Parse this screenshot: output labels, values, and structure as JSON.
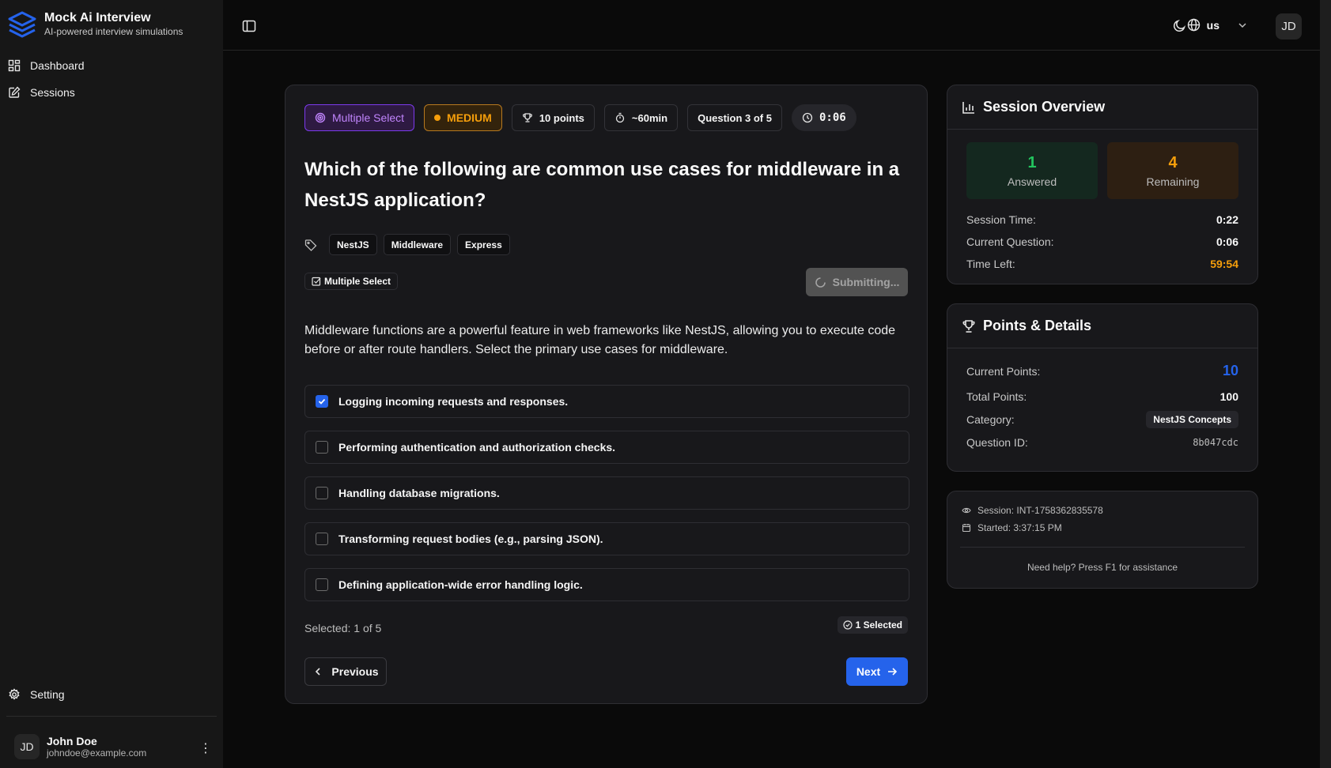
{
  "app": {
    "title": "Mock Ai Interview",
    "subtitle": "AI-powered interview simulations"
  },
  "sidebar": {
    "items": [
      {
        "label": "Dashboard",
        "icon": "dashboard-icon"
      },
      {
        "label": "Sessions",
        "icon": "sessions-icon"
      }
    ],
    "setting_label": "Setting"
  },
  "user": {
    "initials": "JD",
    "name": "John Doe",
    "email": "johndoe@example.com"
  },
  "topbar": {
    "language": "us",
    "avatar_initials": "JD"
  },
  "question_card": {
    "chips": {
      "type": "Multiple Select",
      "difficulty": "MEDIUM",
      "points": "10 points",
      "duration": "~60min",
      "progress": "Question 3 of 5",
      "timer": "0:06"
    },
    "question": "Which of the following are common use cases for middleware in a NestJS application?",
    "tags": [
      "NestJS",
      "Middleware",
      "Express"
    ],
    "type_badge": "Multiple Select",
    "submit_label": "Submitting...",
    "description": "Middleware functions are a powerful feature in web frameworks like NestJS, allowing you to execute code before or after route handlers. Select the primary use cases for middleware.",
    "options": [
      {
        "label": "Logging incoming requests and responses.",
        "checked": true
      },
      {
        "label": "Performing authentication and authorization checks.",
        "checked": false
      },
      {
        "label": "Handling database migrations.",
        "checked": false
      },
      {
        "label": "Transforming request bodies (e.g., parsing JSON).",
        "checked": false
      },
      {
        "label": "Defining application-wide error handling logic.",
        "checked": false
      }
    ],
    "selected_count": "Selected: 1 of 5",
    "selected_badge": "1 Selected",
    "prev_label": "Previous",
    "next_label": "Next"
  },
  "session_overview": {
    "title": "Session Overview",
    "answered": {
      "value": "1",
      "label": "Answered"
    },
    "remaining": {
      "value": "4",
      "label": "Remaining"
    },
    "rows": [
      {
        "label": "Session Time:",
        "value": "0:22"
      },
      {
        "label": "Current Question:",
        "value": "0:06"
      },
      {
        "label": "Time Left:",
        "value": "59:54"
      }
    ]
  },
  "points_details": {
    "title": "Points & Details",
    "current_points_label": "Current Points:",
    "current_points": "10",
    "total_points_label": "Total Points:",
    "total_points": "100",
    "category_label": "Category:",
    "category": "NestJS Concepts",
    "question_id_label": "Question ID:",
    "question_id": "8b047cdc"
  },
  "session_meta": {
    "session": "Session: INT-1758362835578",
    "started": "Started: 3:37:15 PM",
    "help": "Need help? Press F1 for assistance"
  },
  "colors": {
    "accent": "#2563eb",
    "success": "#22c55e",
    "warning": "#f59e0b",
    "purple": "#c084fc"
  }
}
